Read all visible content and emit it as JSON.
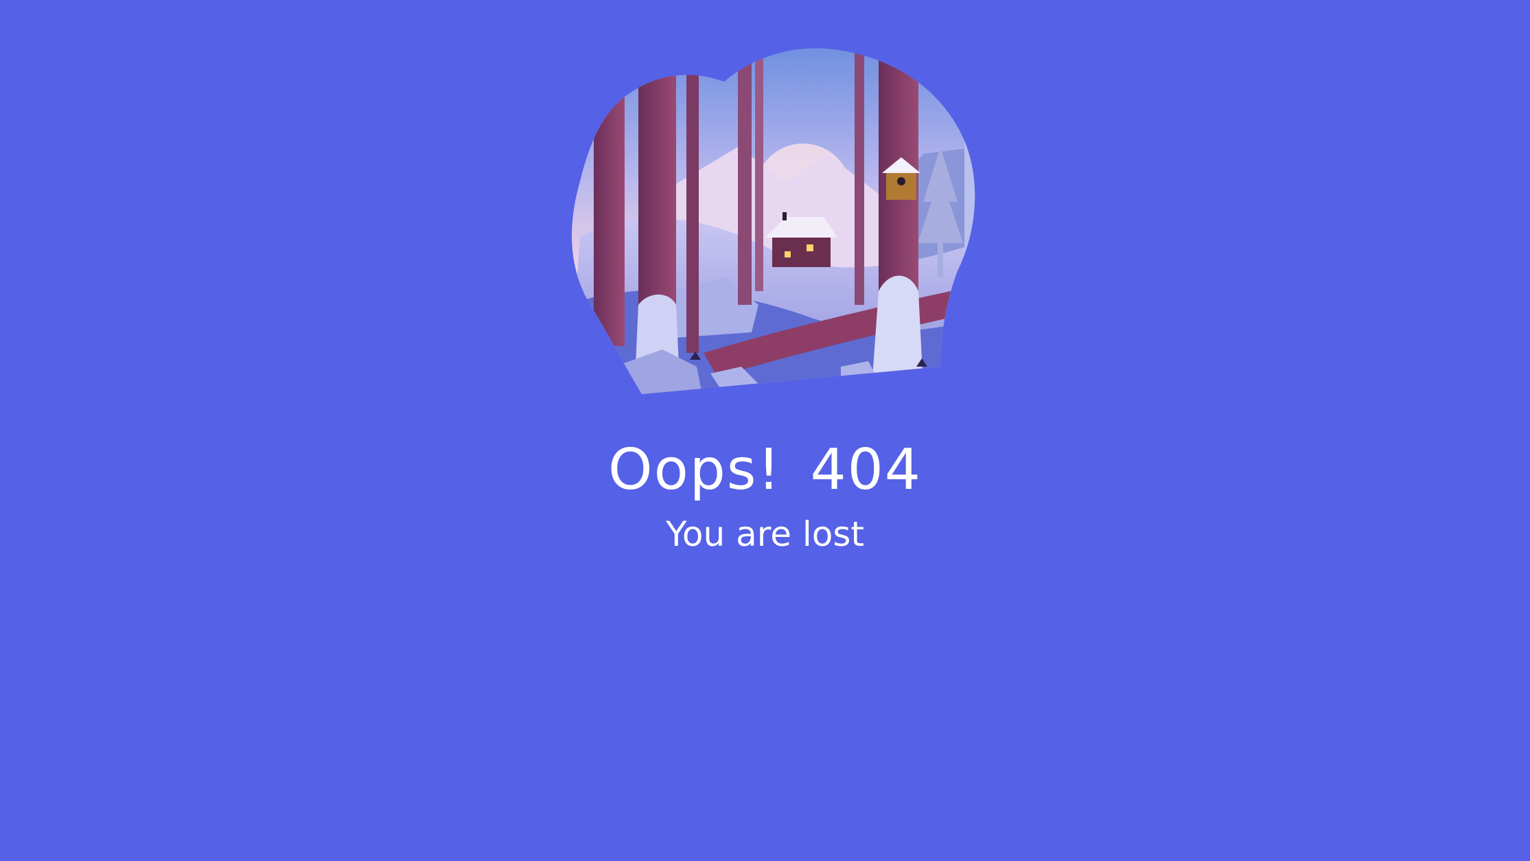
{
  "error_page": {
    "title": "Oops!  404",
    "subtitle": "You are lost",
    "illustration_icon": "winter-forest-cabin-illustration"
  },
  "colors": {
    "background": "#5561e6",
    "text": "#ffffff"
  }
}
